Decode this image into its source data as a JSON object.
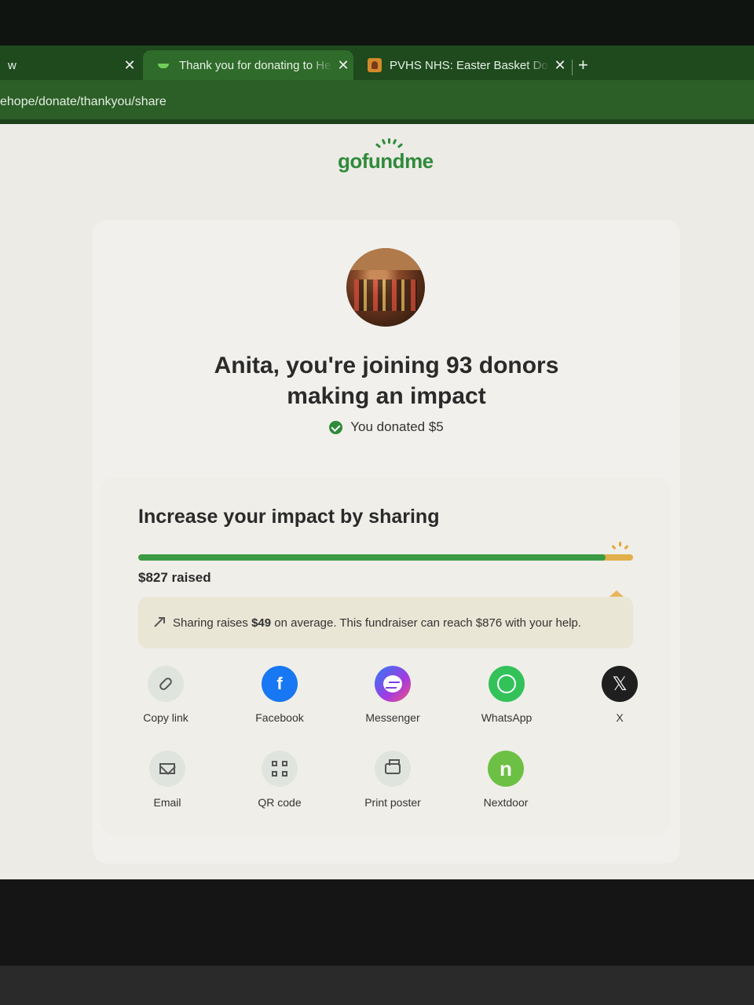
{
  "browser": {
    "tabs": [
      {
        "title": "w",
        "active": false
      },
      {
        "title": "Thank you for donating to He",
        "active": true
      },
      {
        "title": "PVHS NHS: Easter Basket Do",
        "active": false
      }
    ],
    "new_tab_label": "+",
    "url": "ehope/donate/thankyou/share"
  },
  "brand": {
    "logo_text": "gofundme",
    "color": "#2f8a3a"
  },
  "confirmation": {
    "headline_line1": "Anita, you're joining 93 donors",
    "headline_line2": "making an impact",
    "donated_text": "You donated $5"
  },
  "share": {
    "title": "Increase your impact by sharing",
    "raised_text": "$827 raised",
    "progress_fraction": 0.944,
    "tip_prefix": "Sharing raises ",
    "tip_amount": "$49",
    "tip_suffix": " on average. This fundraiser can reach $876 with your help.",
    "options": [
      {
        "label": "Copy link",
        "icon": "link-icon"
      },
      {
        "label": "Facebook",
        "icon": "facebook-icon"
      },
      {
        "label": "Messenger",
        "icon": "messenger-icon"
      },
      {
        "label": "WhatsApp",
        "icon": "whatsapp-icon"
      },
      {
        "label": "X",
        "icon": "x-icon"
      },
      {
        "label": "Email",
        "icon": "email-icon"
      },
      {
        "label": "QR code",
        "icon": "qr-code-icon"
      },
      {
        "label": "Print poster",
        "icon": "printer-icon"
      },
      {
        "label": "Nextdoor",
        "icon": "nextdoor-icon"
      }
    ]
  },
  "colors": {
    "progress_green": "#3b9a44",
    "progress_goal": "#e2b04a",
    "tip_bg": "#eae6d5"
  }
}
